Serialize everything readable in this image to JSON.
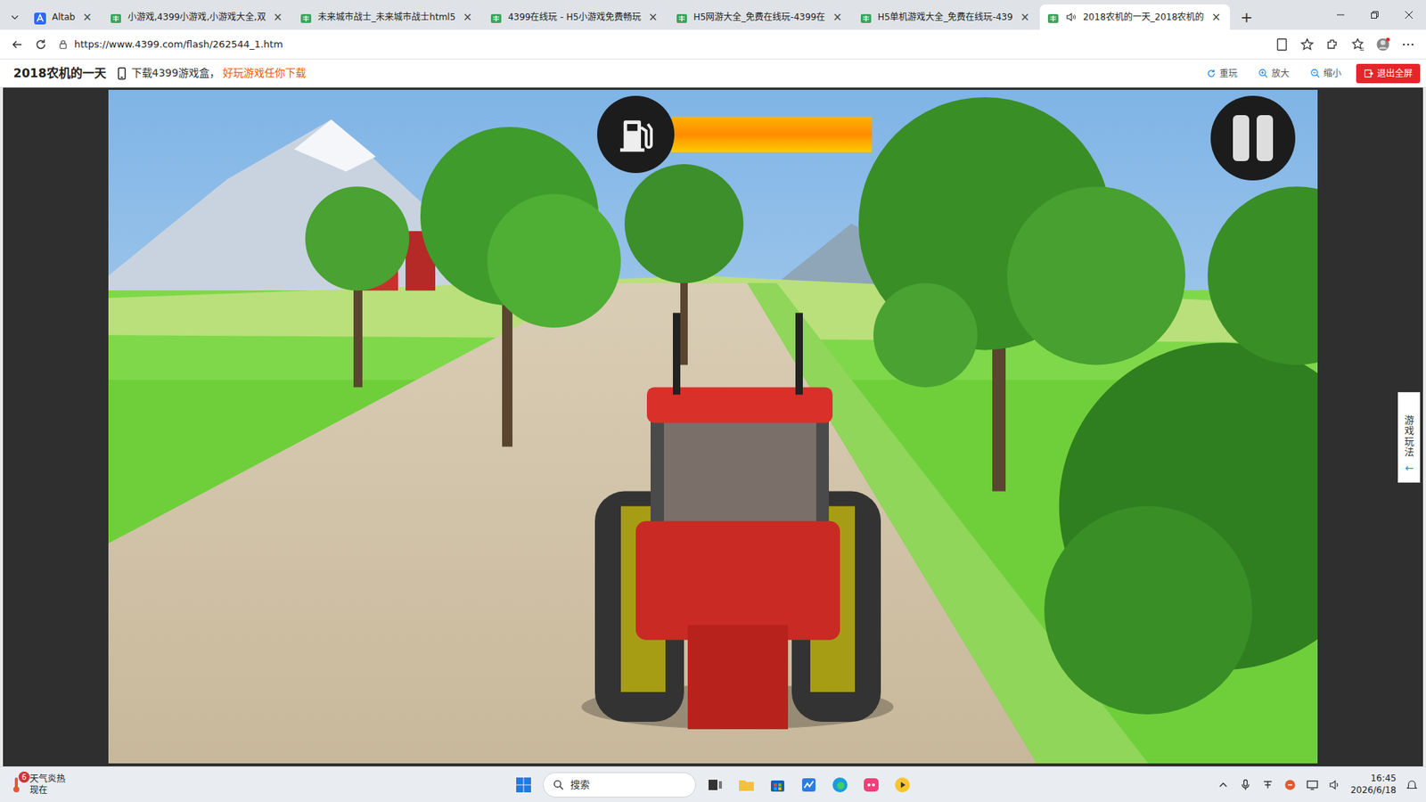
{
  "browser": {
    "tabs": [
      {
        "label": "Altab",
        "selected": false
      },
      {
        "label": "小游戏,4399小游戏,小游戏大全,双",
        "selected": false
      },
      {
        "label": "未来城市战士_未来城市战士html5",
        "selected": false
      },
      {
        "label": "4399在线玩 - H5小游戏免费畅玩",
        "selected": false
      },
      {
        "label": "H5网游大全_免费在线玩-4399在",
        "selected": false
      },
      {
        "label": "H5单机游戏大全_免费在线玩-439",
        "selected": false
      },
      {
        "label": "2018农机的一天_2018农机的",
        "selected": true
      }
    ],
    "tab_close": "×",
    "new_tab": "+",
    "address": "https://www.4399.com/flash/262544_1.htm"
  },
  "page_header": {
    "title": "2018农机的一天",
    "promo": "下载4399游戏盒，",
    "promo_link": "好玩游戏任你下载",
    "buttons": [
      "重玩",
      "放大",
      "缩小",
      "退出全屏"
    ]
  },
  "game": {
    "fuel": {
      "level": 1
    }
  },
  "side_tab": {
    "label": "游戏玩法",
    "arrow": "←"
  },
  "taskbar": {
    "weather": {
      "badge": "6",
      "title": "天气炎热",
      "subtitle": "现在"
    },
    "search": {
      "placeholder": "搜索"
    },
    "time": "16:45",
    "date": "2026/6/18"
  }
}
